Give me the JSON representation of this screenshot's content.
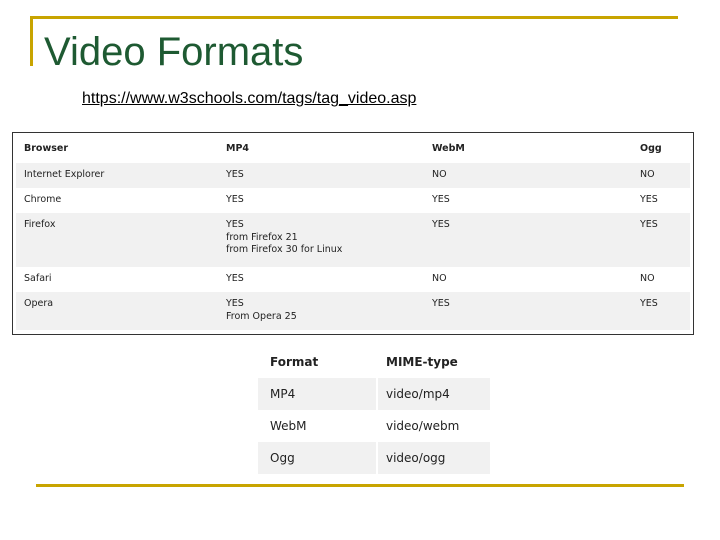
{
  "slide": {
    "title": "Video Formats",
    "link": "https://www.w3schools.com/tags/tag_video.asp"
  },
  "browser_table": {
    "headers": [
      "Browser",
      "MP4",
      "WebM",
      "Ogg"
    ],
    "rows": [
      {
        "browser": "Internet Explorer",
        "mp4": [
          "YES"
        ],
        "webm": "NO",
        "ogg": "NO"
      },
      {
        "browser": "Chrome",
        "mp4": [
          "YES"
        ],
        "webm": "YES",
        "ogg": "YES"
      },
      {
        "browser": "Firefox",
        "mp4": [
          "YES",
          "from Firefox 21",
          "from Firefox 30 for Linux"
        ],
        "webm": "YES",
        "ogg": "YES"
      },
      {
        "browser": "Safari",
        "mp4": [
          "YES"
        ],
        "webm": "NO",
        "ogg": "NO"
      },
      {
        "browser": "Opera",
        "mp4": [
          "YES",
          "From Opera 25"
        ],
        "webm": "YES",
        "ogg": "YES"
      }
    ]
  },
  "mime_table": {
    "headers": [
      "Format",
      "MIME-type"
    ],
    "rows": [
      {
        "format": "MP4",
        "mime": "video/mp4"
      },
      {
        "format": "WebM",
        "mime": "video/webm"
      },
      {
        "format": "Ogg",
        "mime": "video/ogg"
      }
    ]
  }
}
